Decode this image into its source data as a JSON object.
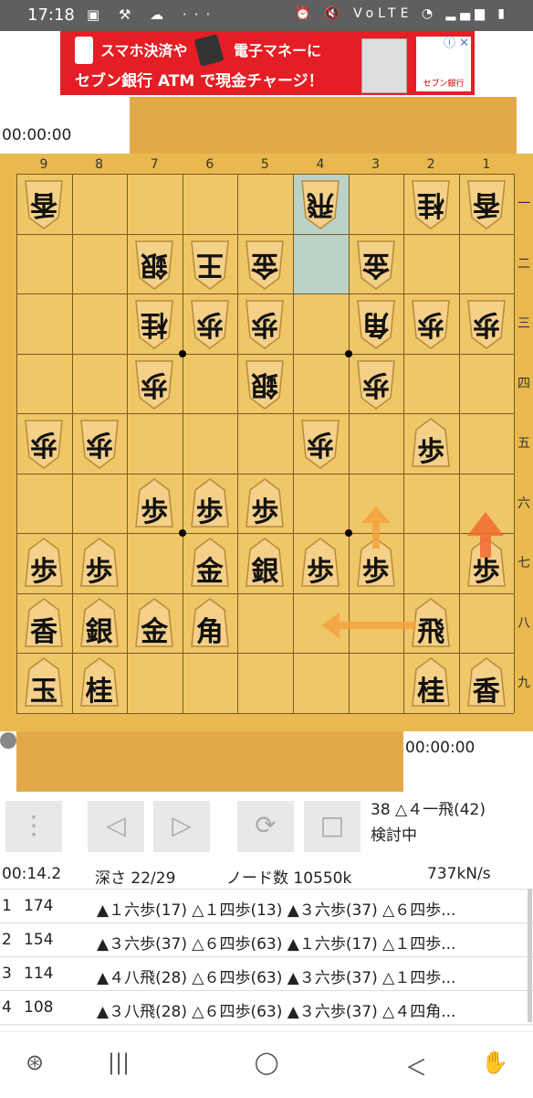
{
  "status_bar": {
    "time": "17:18",
    "left_icons": "▣ ⚒ ☁ ···",
    "right_icons": "⏰ 🔇 VoLTE ◔ ▂▄▆ ▮"
  },
  "ad": {
    "line1a": "スマホ決済や",
    "line1b": "電子マネーに",
    "line2": "セブン銀行 ATM で現金チャージ！",
    "bank": "セブン銀行",
    "info": "ⓘ ✕"
  },
  "clock": {
    "top": "00:00:00",
    "bottom": "00:00:00"
  },
  "board": {
    "col_labels": [
      "9",
      "8",
      "7",
      "6",
      "5",
      "4",
      "3",
      "2",
      "1"
    ],
    "row_labels": [
      "一",
      "二",
      "三",
      "四",
      "五",
      "六",
      "七",
      "八",
      "九"
    ],
    "pieces": [
      {
        "sq": "91",
        "k": "香",
        "g": true
      },
      {
        "sq": "41",
        "k": "飛",
        "g": true
      },
      {
        "sq": "21",
        "k": "桂",
        "g": true
      },
      {
        "sq": "11",
        "k": "香",
        "g": true
      },
      {
        "sq": "72",
        "k": "銀",
        "g": true
      },
      {
        "sq": "62",
        "k": "王",
        "g": true
      },
      {
        "sq": "52",
        "k": "金",
        "g": true
      },
      {
        "sq": "32",
        "k": "金",
        "g": true
      },
      {
        "sq": "73",
        "k": "桂",
        "g": true
      },
      {
        "sq": "63",
        "k": "歩",
        "g": true
      },
      {
        "sq": "53",
        "k": "歩",
        "g": true
      },
      {
        "sq": "33",
        "k": "角",
        "g": true
      },
      {
        "sq": "23",
        "k": "歩",
        "g": true
      },
      {
        "sq": "13",
        "k": "歩",
        "g": true
      },
      {
        "sq": "74",
        "k": "歩",
        "g": true
      },
      {
        "sq": "54",
        "k": "銀",
        "g": true
      },
      {
        "sq": "34",
        "k": "歩",
        "g": true
      },
      {
        "sq": "95",
        "k": "歩",
        "g": true
      },
      {
        "sq": "85",
        "k": "歩",
        "g": true
      },
      {
        "sq": "45",
        "k": "歩",
        "g": true
      },
      {
        "sq": "25",
        "k": "歩",
        "g": false
      },
      {
        "sq": "76",
        "k": "歩",
        "g": false
      },
      {
        "sq": "66",
        "k": "歩",
        "g": false
      },
      {
        "sq": "56",
        "k": "歩",
        "g": false
      },
      {
        "sq": "97",
        "k": "歩",
        "g": false
      },
      {
        "sq": "87",
        "k": "歩",
        "g": false
      },
      {
        "sq": "67",
        "k": "金",
        "g": false
      },
      {
        "sq": "57",
        "k": "銀",
        "g": false
      },
      {
        "sq": "47",
        "k": "歩",
        "g": false
      },
      {
        "sq": "37",
        "k": "歩",
        "g": false
      },
      {
        "sq": "17",
        "k": "歩",
        "g": false
      },
      {
        "sq": "98",
        "k": "香",
        "g": false
      },
      {
        "sq": "88",
        "k": "銀",
        "g": false
      },
      {
        "sq": "78",
        "k": "金",
        "g": false
      },
      {
        "sq": "68",
        "k": "角",
        "g": false
      },
      {
        "sq": "28",
        "k": "飛",
        "g": false
      },
      {
        "sq": "99",
        "k": "玉",
        "g": false
      },
      {
        "sq": "89",
        "k": "桂",
        "g": false
      },
      {
        "sq": "29",
        "k": "桂",
        "g": false
      },
      {
        "sq": "19",
        "k": "香",
        "g": false
      }
    ],
    "highlight_squares": [
      "41",
      "42"
    ]
  },
  "controls": {
    "menu_icon": "⋮",
    "prev_icon": "◁",
    "next_icon": "▷",
    "rotate_icon": "⟳",
    "stop_icon": "□"
  },
  "move_info": {
    "last_move": "38 △４一飛(42)",
    "state": "検討中"
  },
  "stats": {
    "elapsed": "00:14.2",
    "depth": "深さ 22/29",
    "nodes": "ノード数 10550k",
    "nps": "737kN/s"
  },
  "pv_lines": [
    {
      "rank": "1",
      "score": "174",
      "moves": "▲１六歩(17) △１四歩(13) ▲３六歩(37) △６四歩..."
    },
    {
      "rank": "2",
      "score": "154",
      "moves": "▲３六歩(37) △６四歩(63) ▲１六歩(17) △１四歩..."
    },
    {
      "rank": "3",
      "score": "114",
      "moves": "▲４八飛(28) △６四歩(63) ▲３六歩(37) △１四歩..."
    },
    {
      "rank": "4",
      "score": "108",
      "moves": "▲３八飛(28) △６四歩(63) ▲３六歩(37) △４四角..."
    }
  ],
  "nav": {
    "app_icon": "⊛",
    "recents_icon": "|||",
    "home_icon": "◯",
    "back_icon": "＜",
    "assist_icon": "✋"
  },
  "colors": {
    "board": "#efc766",
    "arrow_red": "#f06a32",
    "arrow_orange": "#f5a140",
    "highlight": "#a9d6e8"
  }
}
